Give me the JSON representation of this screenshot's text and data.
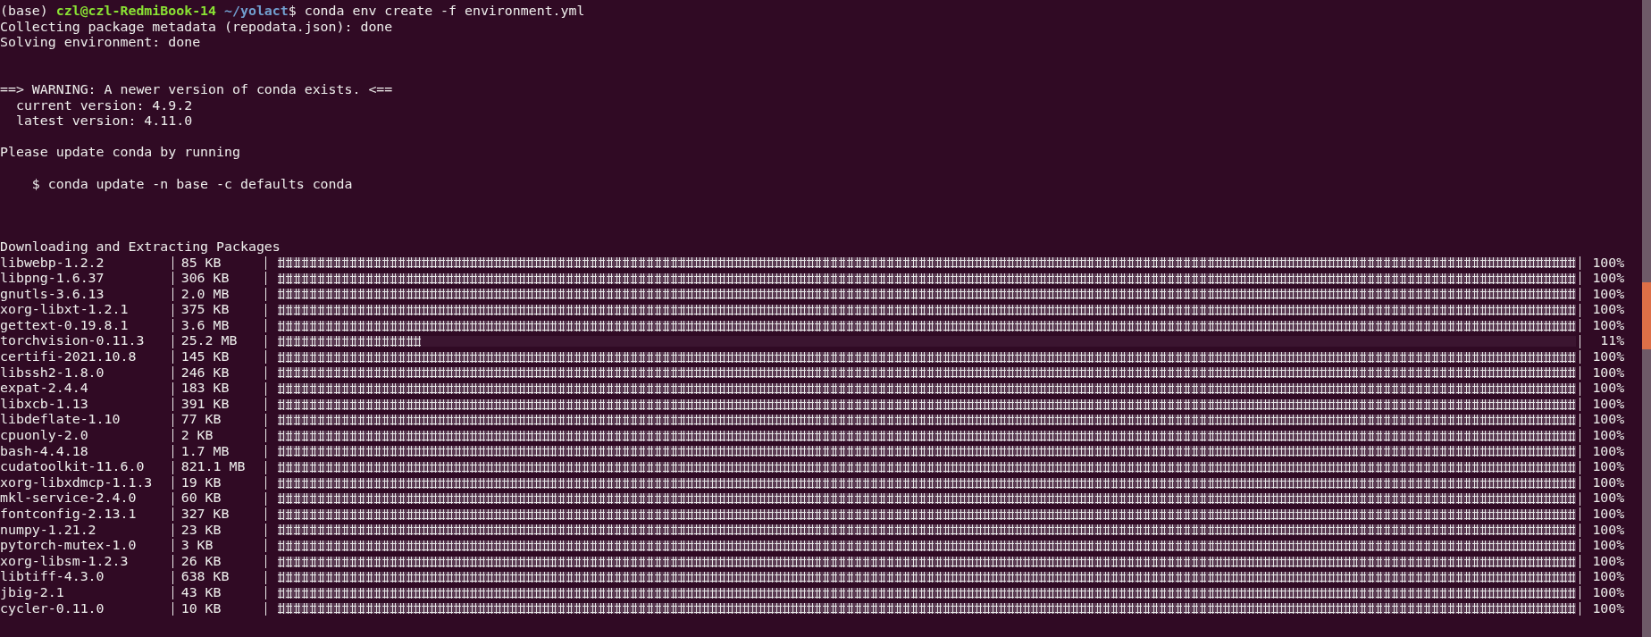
{
  "prompt": {
    "env": "(base)",
    "user_host": "czl@czl-RedmiBook-14",
    "path": "~/yolact",
    "command": "$ conda env create -f environment.yml"
  },
  "output": [
    {
      "kind": "text",
      "text": "Collecting package metadata (repodata.json): done"
    },
    {
      "kind": "text",
      "text": "Solving environment: done"
    },
    {
      "kind": "blank"
    },
    {
      "kind": "blank"
    },
    {
      "kind": "text",
      "text": "==> WARNING: A newer version of conda exists. <=="
    },
    {
      "kind": "text",
      "text": "  current version: 4.9.2"
    },
    {
      "kind": "text",
      "text": "  latest version: 4.11.0"
    },
    {
      "kind": "blank"
    },
    {
      "kind": "text",
      "text": "Please update conda by running"
    },
    {
      "kind": "blank"
    },
    {
      "kind": "text",
      "text": "    $ conda update -n base -c defaults conda"
    },
    {
      "kind": "blank"
    },
    {
      "kind": "blank"
    },
    {
      "kind": "blank"
    },
    {
      "kind": "text",
      "text": "Downloading and Extracting Packages"
    }
  ],
  "packages": [
    {
      "name": "libwebp-1.2.2",
      "size": "85 KB",
      "level": 1,
      "percent": "100%"
    },
    {
      "name": "libpng-1.6.37",
      "size": "306 KB",
      "level": 1,
      "percent": "100%"
    },
    {
      "name": "gnutls-3.6.13",
      "size": "2.0 MB",
      "level": 1,
      "percent": "100%"
    },
    {
      "name": "xorg-libxt-1.2.1",
      "size": "375 KB",
      "level": 1,
      "percent": "100%"
    },
    {
      "name": "gettext-0.19.8.1",
      "size": "3.6 MB",
      "level": 1,
      "percent": "100%"
    },
    {
      "name": "torchvision-0.11.3",
      "size": "25.2 MB",
      "level": 0.11,
      "percent": "11%"
    },
    {
      "name": "certifi-2021.10.8",
      "size": "145 KB",
      "level": 1,
      "percent": "100%"
    },
    {
      "name": "libssh2-1.8.0",
      "size": "246 KB",
      "level": 1,
      "percent": "100%"
    },
    {
      "name": "expat-2.4.4",
      "size": "183 KB",
      "level": 1,
      "percent": "100%"
    },
    {
      "name": "libxcb-1.13",
      "size": "391 KB",
      "level": 1,
      "percent": "100%"
    },
    {
      "name": "libdeflate-1.10",
      "size": "77 KB",
      "level": 1,
      "percent": "100%"
    },
    {
      "name": "cpuonly-2.0",
      "size": "2 KB",
      "level": 1,
      "percent": "100%"
    },
    {
      "name": "bash-4.4.18",
      "size": "1.7 MB",
      "level": 1,
      "percent": "100%"
    },
    {
      "name": "cudatoolkit-11.6.0",
      "size": "821.1 MB",
      "level": 1,
      "percent": "100%"
    },
    {
      "name": "xorg-libxdmcp-1.1.3",
      "size": "19 KB",
      "level": 1,
      "percent": "100%"
    },
    {
      "name": "mkl-service-2.4.0",
      "size": "60 KB",
      "level": 1,
      "percent": "100%"
    },
    {
      "name": "fontconfig-2.13.1",
      "size": "327 KB",
      "level": 1,
      "percent": "100%"
    },
    {
      "name": "numpy-1.21.2",
      "size": "23 KB",
      "level": 1,
      "percent": "100%"
    },
    {
      "name": "pytorch-mutex-1.0",
      "size": "3 KB",
      "level": 1,
      "percent": "100%"
    },
    {
      "name": "xorg-libsm-1.2.3",
      "size": "26 KB",
      "level": 1,
      "percent": "100%"
    },
    {
      "name": "libtiff-4.3.0",
      "size": "638 KB",
      "level": 1,
      "percent": "100%"
    },
    {
      "name": "jbig-2.1",
      "size": "43 KB",
      "level": 1,
      "percent": "100%"
    },
    {
      "name": "cycler-0.11.0",
      "size": "10 KB",
      "level": 1,
      "percent": "100%"
    }
  ]
}
